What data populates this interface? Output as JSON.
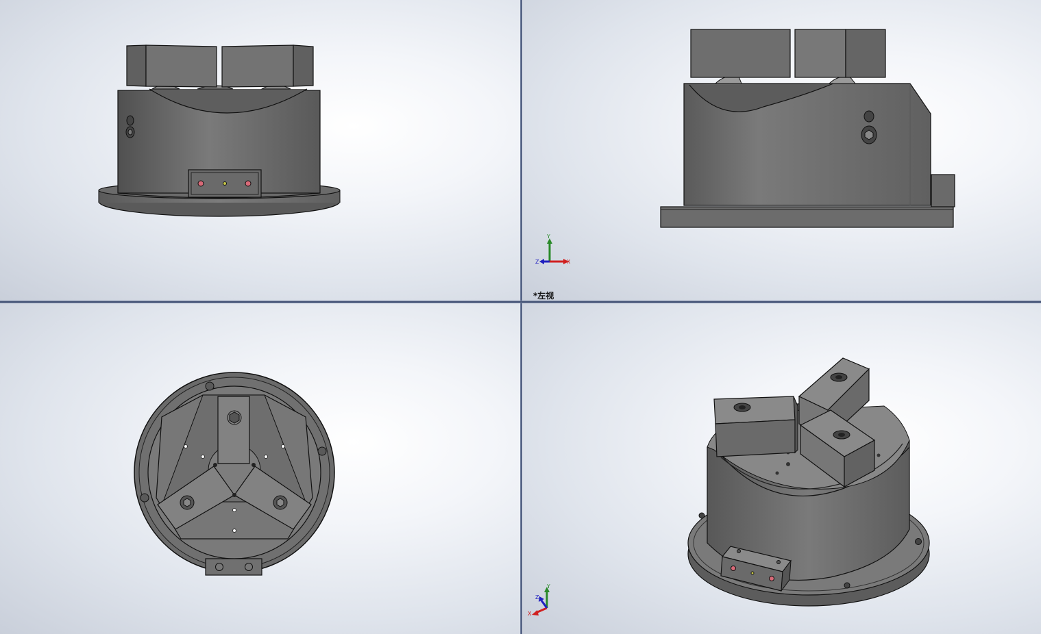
{
  "viewports": {
    "top_left": {
      "id": "front"
    },
    "top_right": {
      "id": "left",
      "view_label": "*左视",
      "triad": {
        "axis_y": "Y",
        "axis_z": "Z",
        "axis_x": "X"
      }
    },
    "bottom_left": {
      "id": "bottom"
    },
    "bottom_right": {
      "id": "isometric",
      "triad": {
        "axis_y": "Y",
        "axis_z": "Z",
        "axis_x": "X"
      }
    }
  },
  "colors": {
    "part_body": "#6e6e6e",
    "edge": "#111111",
    "triad_y": "#2a8a2a",
    "triad_x": "#d02020",
    "triad_z": "#2020c0",
    "led": "#d86a78",
    "divider": "#2a3a5e"
  }
}
